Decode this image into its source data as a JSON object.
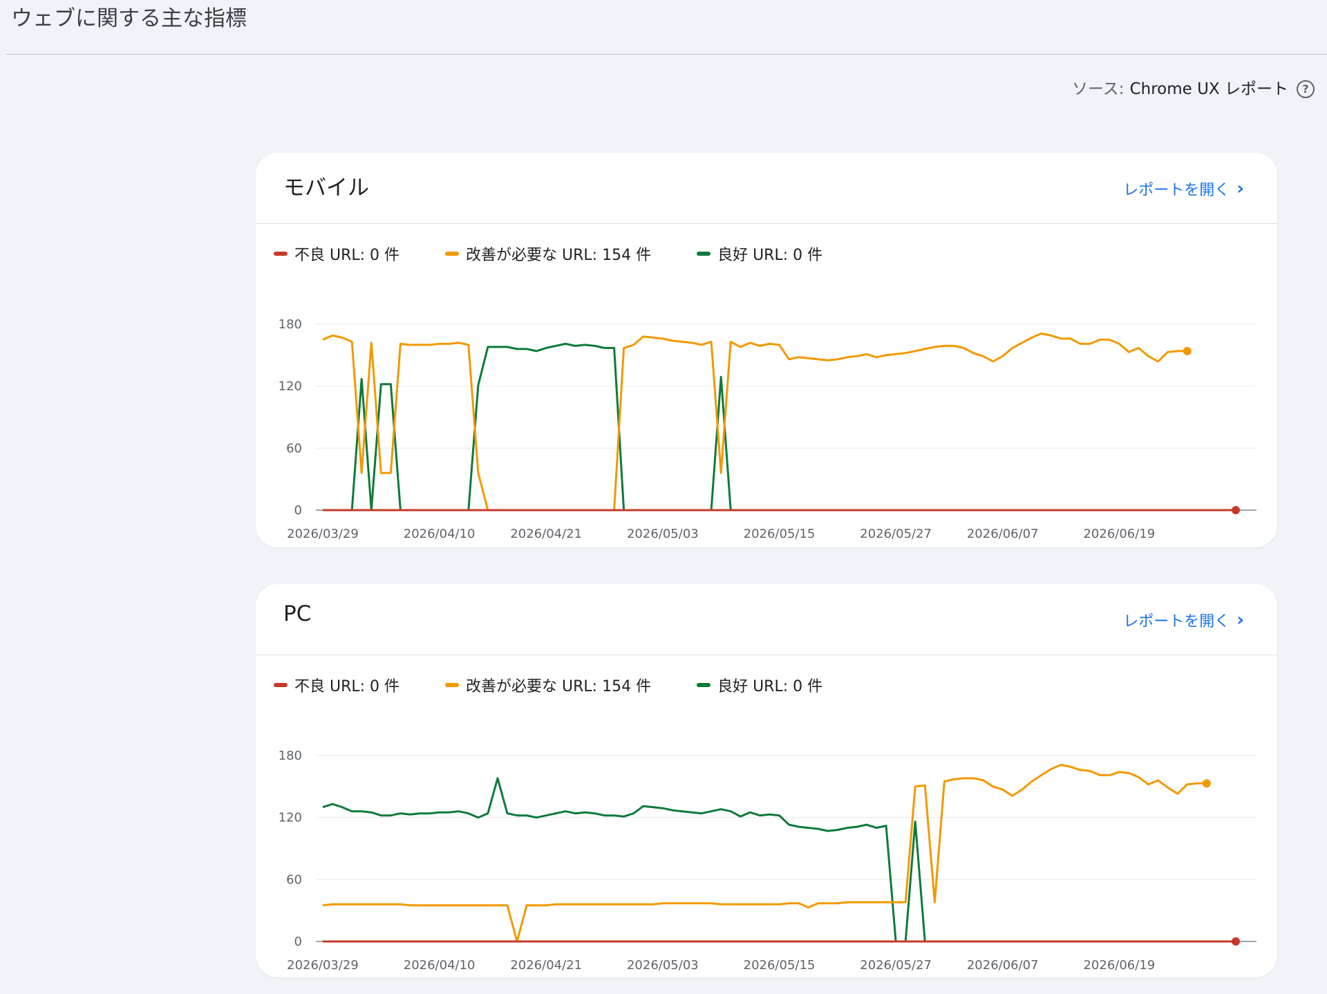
{
  "page": {
    "title": "ウェブに関する主な指標",
    "source_label": "ソース:",
    "source_value": "Chrome UX レポート",
    "help_icon": "help-circle-icon"
  },
  "colors": {
    "poor": "#c5392a",
    "needs": "#f29900",
    "good": "#0d7a3a",
    "link": "#1a73e8",
    "grid": "#e8eaed"
  },
  "cards": [
    {
      "title": "モバイル",
      "open_report": "レポートを開く",
      "legend": [
        {
          "label": "不良 URL: 0 件",
          "color": "#c5392a"
        },
        {
          "label": "改善が必要な URL: 154 件",
          "color": "#f29900"
        },
        {
          "label": "良好 URL: 0 件",
          "color": "#0d7a3a"
        }
      ]
    },
    {
      "title": "PC",
      "open_report": "レポートを開く",
      "legend": [
        {
          "label": "不良 URL: 0 件",
          "color": "#c5392a"
        },
        {
          "label": "改善が必要な URL: 154 件",
          "color": "#f29900"
        },
        {
          "label": "良好 URL: 0 件",
          "color": "#0d7a3a"
        }
      ]
    }
  ],
  "chart_data": [
    {
      "type": "line",
      "title": "モバイル",
      "xlabel": "",
      "ylabel": "",
      "ylim": [
        0,
        180
      ],
      "yticks": [
        0,
        60,
        120,
        180
      ],
      "x_start": "2026/03/29",
      "x_end": "2026/07/01",
      "x_ticks": [
        "2026/03/29",
        "2026/04/10",
        "2026/04/21",
        "2026/05/03",
        "2026/05/15",
        "2026/05/27",
        "2026/06/07",
        "2026/06/19"
      ],
      "grid": true,
      "series": [
        {
          "name": "不良 URL: 0 件",
          "color": "#c5392a",
          "points": [
            [
              "2026/03/29",
              0
            ],
            [
              "2026/07/01",
              0
            ]
          ],
          "end_marker": true
        },
        {
          "name": "改善が必要な URL: 154 件",
          "color": "#f29900",
          "end_marker": true,
          "points": [
            [
              "2026/03/29",
              165
            ],
            [
              "2026/03/30",
              169
            ],
            [
              "2026/03/31",
              167
            ],
            [
              "2026/04/01",
              163
            ],
            [
              "2026/04/02",
              36
            ],
            [
              "2026/04/03",
              162
            ],
            [
              "2026/04/04",
              36
            ],
            [
              "2026/04/05",
              36
            ],
            [
              "2026/04/06",
              161
            ],
            [
              "2026/04/07",
              160
            ],
            [
              "2026/04/08",
              160
            ],
            [
              "2026/04/09",
              160
            ],
            [
              "2026/04/10",
              161
            ],
            [
              "2026/04/11",
              161
            ],
            [
              "2026/04/12",
              162
            ],
            [
              "2026/04/13",
              160
            ],
            [
              "2026/04/14",
              36
            ],
            [
              "2026/04/15",
              0
            ],
            [
              "2026/04/28",
              0
            ],
            [
              "2026/04/29",
              157
            ],
            [
              "2026/04/30",
              160
            ],
            [
              "2026/05/01",
              168
            ],
            [
              "2026/05/02",
              167
            ],
            [
              "2026/05/03",
              166
            ],
            [
              "2026/05/04",
              164
            ],
            [
              "2026/05/05",
              163
            ],
            [
              "2026/05/06",
              162
            ],
            [
              "2026/05/07",
              160
            ],
            [
              "2026/05/08",
              163
            ],
            [
              "2026/05/09",
              36
            ],
            [
              "2026/05/10",
              163
            ],
            [
              "2026/05/11",
              158
            ],
            [
              "2026/05/12",
              162
            ],
            [
              "2026/05/13",
              159
            ],
            [
              "2026/05/14",
              161
            ],
            [
              "2026/05/15",
              160
            ],
            [
              "2026/05/16",
              146
            ],
            [
              "2026/05/17",
              148
            ],
            [
              "2026/05/18",
              147
            ],
            [
              "2026/05/19",
              146
            ],
            [
              "2026/05/20",
              145
            ],
            [
              "2026/05/21",
              146
            ],
            [
              "2026/05/22",
              148
            ],
            [
              "2026/05/23",
              149
            ],
            [
              "2026/05/24",
              151
            ],
            [
              "2026/05/25",
              148
            ],
            [
              "2026/05/26",
              150
            ],
            [
              "2026/05/27",
              151
            ],
            [
              "2026/05/28",
              152
            ],
            [
              "2026/05/29",
              154
            ],
            [
              "2026/05/30",
              156
            ],
            [
              "2026/05/31",
              158
            ],
            [
              "2026/06/01",
              159
            ],
            [
              "2026/06/02",
              159
            ],
            [
              "2026/06/03",
              157
            ],
            [
              "2026/06/04",
              152
            ],
            [
              "2026/06/05",
              149
            ],
            [
              "2026/06/06",
              144
            ],
            [
              "2026/06/07",
              149
            ],
            [
              "2026/06/08",
              157
            ],
            [
              "2026/06/09",
              162
            ],
            [
              "2026/06/10",
              167
            ],
            [
              "2026/06/11",
              171
            ],
            [
              "2026/06/12",
              169
            ],
            [
              "2026/06/13",
              166
            ],
            [
              "2026/06/14",
              166
            ],
            [
              "2026/06/15",
              161
            ],
            [
              "2026/06/16",
              161
            ],
            [
              "2026/06/17",
              165
            ],
            [
              "2026/06/18",
              165
            ],
            [
              "2026/06/19",
              161
            ],
            [
              "2026/06/20",
              153
            ],
            [
              "2026/06/21",
              157
            ],
            [
              "2026/06/22",
              149
            ],
            [
              "2026/06/23",
              144
            ],
            [
              "2026/06/24",
              153
            ],
            [
              "2026/06/25",
              154
            ],
            [
              "2026/06/26",
              154
            ]
          ]
        },
        {
          "name": "良好 URL: 0 件",
          "color": "#0d7a3a",
          "points": [
            [
              "2026/03/29",
              0
            ],
            [
              "2026/04/01",
              0
            ],
            [
              "2026/04/02",
              127
            ],
            [
              "2026/04/03",
              0
            ],
            [
              "2026/04/04",
              122
            ],
            [
              "2026/04/05",
              122
            ],
            [
              "2026/04/06",
              0
            ],
            [
              "2026/04/13",
              0
            ],
            [
              "2026/04/14",
              121
            ],
            [
              "2026/04/15",
              158
            ],
            [
              "2026/04/16",
              158
            ],
            [
              "2026/04/17",
              158
            ],
            [
              "2026/04/18",
              156
            ],
            [
              "2026/04/19",
              156
            ],
            [
              "2026/04/20",
              154
            ],
            [
              "2026/04/21",
              157
            ],
            [
              "2026/04/22",
              159
            ],
            [
              "2026/04/23",
              161
            ],
            [
              "2026/04/24",
              159
            ],
            [
              "2026/04/25",
              160
            ],
            [
              "2026/04/26",
              159
            ],
            [
              "2026/04/27",
              157
            ],
            [
              "2026/04/28",
              157
            ],
            [
              "2026/04/29",
              0
            ],
            [
              "2026/05/08",
              0
            ],
            [
              "2026/05/09",
              129
            ],
            [
              "2026/05/10",
              0
            ],
            [
              "2026/06/26",
              0
            ]
          ]
        }
      ]
    },
    {
      "type": "line",
      "title": "PC",
      "xlabel": "",
      "ylabel": "",
      "ylim": [
        0,
        180
      ],
      "yticks": [
        0,
        60,
        120,
        180
      ],
      "x_start": "2026/03/29",
      "x_end": "2026/07/01",
      "x_ticks": [
        "2026/03/29",
        "2026/04/10",
        "2026/04/21",
        "2026/05/03",
        "2026/05/15",
        "2026/05/27",
        "2026/06/07",
        "2026/06/19"
      ],
      "grid": true,
      "series": [
        {
          "name": "不良 URL: 0 件",
          "color": "#c5392a",
          "points": [
            [
              "2026/03/29",
              0
            ],
            [
              "2026/07/01",
              0
            ]
          ],
          "end_marker": true
        },
        {
          "name": "改善が必要な URL: 154 件",
          "color": "#f29900",
          "end_marker": true,
          "points": [
            [
              "2026/03/29",
              35
            ],
            [
              "2026/03/30",
              36
            ],
            [
              "2026/04/06",
              36
            ],
            [
              "2026/04/07",
              35
            ],
            [
              "2026/04/17",
              35
            ],
            [
              "2026/04/18",
              0
            ],
            [
              "2026/04/19",
              35
            ],
            [
              "2026/04/21",
              35
            ],
            [
              "2026/04/22",
              36
            ],
            [
              "2026/05/02",
              36
            ],
            [
              "2026/05/03",
              37
            ],
            [
              "2026/05/08",
              37
            ],
            [
              "2026/05/09",
              36
            ],
            [
              "2026/05/15",
              36
            ],
            [
              "2026/05/16",
              37
            ],
            [
              "2026/05/17",
              37
            ],
            [
              "2026/05/18",
              33
            ],
            [
              "2026/05/19",
              37
            ],
            [
              "2026/05/21",
              37
            ],
            [
              "2026/05/22",
              38
            ],
            [
              "2026/05/27",
              38
            ],
            [
              "2026/05/28",
              38
            ],
            [
              "2026/05/29",
              150
            ],
            [
              "2026/05/30",
              151
            ],
            [
              "2026/05/31",
              38
            ],
            [
              "2026/06/01",
              155
            ],
            [
              "2026/06/02",
              157
            ],
            [
              "2026/06/03",
              158
            ],
            [
              "2026/06/04",
              158
            ],
            [
              "2026/06/05",
              156
            ],
            [
              "2026/06/06",
              150
            ],
            [
              "2026/06/07",
              147
            ],
            [
              "2026/06/08",
              141
            ],
            [
              "2026/06/09",
              147
            ],
            [
              "2026/06/10",
              155
            ],
            [
              "2026/06/11",
              161
            ],
            [
              "2026/06/12",
              167
            ],
            [
              "2026/06/13",
              171
            ],
            [
              "2026/06/14",
              169
            ],
            [
              "2026/06/15",
              166
            ],
            [
              "2026/06/16",
              165
            ],
            [
              "2026/06/17",
              161
            ],
            [
              "2026/06/18",
              161
            ],
            [
              "2026/06/19",
              164
            ],
            [
              "2026/06/20",
              163
            ],
            [
              "2026/06/21",
              159
            ],
            [
              "2026/06/22",
              152
            ],
            [
              "2026/06/23",
              156
            ],
            [
              "2026/06/24",
              149
            ],
            [
              "2026/06/25",
              143
            ],
            [
              "2026/06/26",
              152
            ],
            [
              "2026/06/27",
              153
            ],
            [
              "2026/06/28",
              153
            ]
          ]
        },
        {
          "name": "良好 URL: 0 件",
          "color": "#0d7a3a",
          "points": [
            [
              "2026/03/29",
              130
            ],
            [
              "2026/03/30",
              133
            ],
            [
              "2026/03/31",
              130
            ],
            [
              "2026/04/01",
              126
            ],
            [
              "2026/04/02",
              126
            ],
            [
              "2026/04/03",
              125
            ],
            [
              "2026/04/04",
              122
            ],
            [
              "2026/04/05",
              122
            ],
            [
              "2026/04/06",
              124
            ],
            [
              "2026/04/07",
              123
            ],
            [
              "2026/04/08",
              124
            ],
            [
              "2026/04/09",
              124
            ],
            [
              "2026/04/10",
              125
            ],
            [
              "2026/04/11",
              125
            ],
            [
              "2026/04/12",
              126
            ],
            [
              "2026/04/13",
              124
            ],
            [
              "2026/04/14",
              120
            ],
            [
              "2026/04/15",
              124
            ],
            [
              "2026/04/16",
              158
            ],
            [
              "2026/04/17",
              124
            ],
            [
              "2026/04/18",
              122
            ],
            [
              "2026/04/19",
              122
            ],
            [
              "2026/04/20",
              120
            ],
            [
              "2026/04/21",
              122
            ],
            [
              "2026/04/22",
              124
            ],
            [
              "2026/04/23",
              126
            ],
            [
              "2026/04/24",
              124
            ],
            [
              "2026/04/25",
              125
            ],
            [
              "2026/04/26",
              124
            ],
            [
              "2026/04/27",
              122
            ],
            [
              "2026/04/28",
              122
            ],
            [
              "2026/04/29",
              121
            ],
            [
              "2026/04/30",
              124
            ],
            [
              "2026/05/01",
              131
            ],
            [
              "2026/05/02",
              130
            ],
            [
              "2026/05/03",
              129
            ],
            [
              "2026/05/04",
              127
            ],
            [
              "2026/05/05",
              126
            ],
            [
              "2026/05/06",
              125
            ],
            [
              "2026/05/07",
              124
            ],
            [
              "2026/05/08",
              126
            ],
            [
              "2026/05/09",
              128
            ],
            [
              "2026/05/10",
              126
            ],
            [
              "2026/05/11",
              121
            ],
            [
              "2026/05/12",
              125
            ],
            [
              "2026/05/13",
              122
            ],
            [
              "2026/05/14",
              123
            ],
            [
              "2026/05/15",
              122
            ],
            [
              "2026/05/16",
              113
            ],
            [
              "2026/05/17",
              111
            ],
            [
              "2026/05/18",
              110
            ],
            [
              "2026/05/19",
              109
            ],
            [
              "2026/05/20",
              107
            ],
            [
              "2026/05/21",
              108
            ],
            [
              "2026/05/22",
              110
            ],
            [
              "2026/05/23",
              111
            ],
            [
              "2026/05/24",
              113
            ],
            [
              "2026/05/25",
              110
            ],
            [
              "2026/05/26",
              112
            ],
            [
              "2026/05/27",
              0
            ],
            [
              "2026/05/28",
              0
            ],
            [
              "2026/05/29",
              116
            ],
            [
              "2026/05/30",
              0
            ],
            [
              "2026/06/28",
              0
            ]
          ]
        }
      ]
    }
  ]
}
